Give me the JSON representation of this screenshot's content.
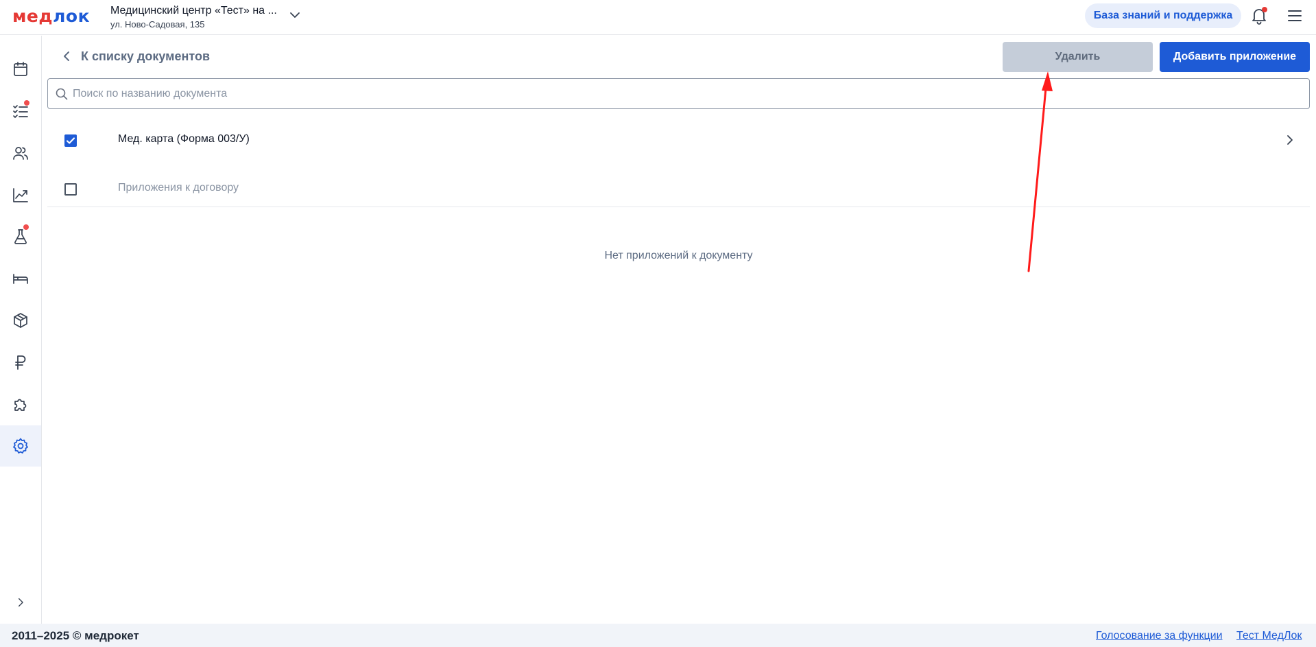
{
  "header": {
    "logo_left": "мед",
    "logo_right": "лок",
    "clinic_name": "Медицинский центр «Тест» на ...",
    "clinic_address": "ул. Ново-Садовая, 135",
    "kb_button": "База знаний и поддержка"
  },
  "sidebar": {
    "items": [
      {
        "icon": "calendar-icon"
      },
      {
        "icon": "checklist-icon",
        "badge": true
      },
      {
        "icon": "users-icon"
      },
      {
        "icon": "chart-icon"
      },
      {
        "icon": "flask-icon",
        "badge": true
      },
      {
        "icon": "bed-icon"
      },
      {
        "icon": "box-icon"
      },
      {
        "icon": "ruble-icon"
      },
      {
        "icon": "puzzle-icon"
      },
      {
        "icon": "gear-icon",
        "active": true
      }
    ],
    "expand_icon": "chevron-right-icon"
  },
  "toolbar": {
    "back_label": "К списку документов",
    "delete_label": "Удалить",
    "add_label": "Добавить приложение"
  },
  "search": {
    "placeholder": "Поиск по названию документа",
    "value": ""
  },
  "documents": [
    {
      "title": "Мед. карта (Форма 003/У)",
      "checked": true
    },
    {
      "title": "Приложения к договору",
      "checked": false
    }
  ],
  "empty_state": "Нет приложений к документу",
  "footer": {
    "copyright": "2011–2025 © медрокет",
    "links": [
      "Голосование за функции",
      "Тест МедЛок"
    ]
  },
  "colors": {
    "brand_blue": "#1e5bd6",
    "brand_red": "#e53935",
    "annotation_arrow": "#ff1a1a"
  }
}
